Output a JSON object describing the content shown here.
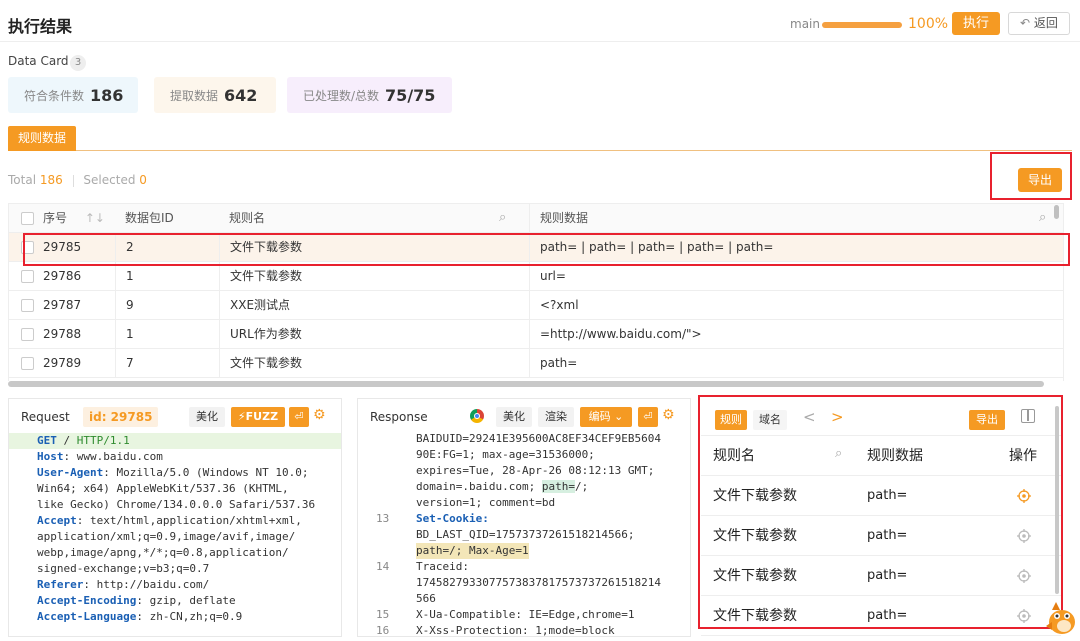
{
  "header": {
    "title": "执行结果",
    "branch": "main",
    "progress": 100,
    "progress_label": "100%",
    "run_label": "执行",
    "back_label": "返回"
  },
  "data_card": {
    "title": "Data Card",
    "count": "3",
    "cards": [
      {
        "label": "符合条件数",
        "value": "186",
        "bg": "#eef7fc"
      },
      {
        "label": "提取数据",
        "value": "642",
        "bg": "#fdf6ec"
      },
      {
        "label": "已处理数/总数",
        "value": "75/75",
        "bg": "#f7eefc"
      }
    ]
  },
  "rules_tab": {
    "label": "规则数据"
  },
  "totals": {
    "total_label": "Total",
    "total": "186",
    "selected_label": "Selected",
    "selected": "0"
  },
  "export_label": "导出",
  "table": {
    "columns": [
      "序号",
      "数据包ID",
      "规则名",
      "规则数据"
    ],
    "rows": [
      {
        "seq": "29785",
        "pkt": "2",
        "rule": "文件下载参数",
        "data": "path= | path= | path= | path= | path="
      },
      {
        "seq": "29786",
        "pkt": "1",
        "rule": "文件下载参数",
        "data": "url="
      },
      {
        "seq": "29787",
        "pkt": "9",
        "rule": "XXE测试点",
        "data": "<?xml"
      },
      {
        "seq": "29788",
        "pkt": "1",
        "rule": "URL作为参数",
        "data": "=http://www.baidu.com/\">"
      },
      {
        "seq": "29789",
        "pkt": "7",
        "rule": "文件下载参数",
        "data": "path="
      }
    ]
  },
  "request": {
    "title": "Request",
    "id_label": "id: 29785",
    "beautify": "美化",
    "fuzz": "FUZZ",
    "lines": [
      {
        "k": "GET",
        "v": " / ",
        "g": "HTTP/1.1"
      },
      {
        "k": "Host",
        "v": ": www.baidu.com"
      },
      {
        "k": "User-Agent",
        "v": ": Mozilla/5.0 (Windows NT 10.0;"
      },
      {
        "v": "Win64; x64) AppleWebKit/537.36 (KHTML,"
      },
      {
        "v": "like Gecko) Chrome/134.0.0.0 Safari/537.36"
      },
      {
        "k": "Accept",
        "v": ": text/html,application/xhtml+xml,"
      },
      {
        "v": "application/xml;q=0.9,image/avif,image/"
      },
      {
        "v": "webp,image/apng,*/*;q=0.8,application/"
      },
      {
        "v": "signed-exchange;v=b3;q=0.7"
      },
      {
        "k": "Referer",
        "v": ": http://baidu.com/"
      },
      {
        "k": "Accept-Encoding",
        "v": ": gzip, deflate"
      },
      {
        "k": "Accept-Language",
        "v": ": zh-CN,zh;q=0.9"
      }
    ]
  },
  "response": {
    "title": "Response",
    "beautify": "美化",
    "render": "渲染",
    "encode": "编码",
    "lines": [
      {
        "n": "",
        "t": "BAIDUID=29241E395600AC8EF34CEF9EB5604"
      },
      {
        "n": "",
        "t": "90E:FG=1; max-age=31536000;"
      },
      {
        "n": "",
        "t": "expires=Tue, 28-Apr-26 08:12:13 GMT;"
      },
      {
        "n": "",
        "t": "domain=.baidu.com; path=/;"
      },
      {
        "n": "",
        "t": "version=1; comment=bd"
      },
      {
        "n": "13",
        "t": "Set-Cookie:",
        "k": true
      },
      {
        "n": "",
        "t": "BD_LAST_QID=17573737261518214566;"
      },
      {
        "n": "",
        "t": "path=/; Max-Age=1"
      },
      {
        "n": "14",
        "t": "Traceid:"
      },
      {
        "n": "",
        "t": "1745827933077573837817573737261518214"
      },
      {
        "n": "",
        "t": "566"
      },
      {
        "n": "15",
        "t": "X-Ua-Compatible: IE=Edge,chrome=1"
      },
      {
        "n": "16",
        "t": "X-Xss-Protection: 1;mode=block"
      }
    ]
  },
  "rule_panel": {
    "tab_rule": "规则",
    "tab_domain": "域名",
    "export": "导出",
    "columns": [
      "规则名",
      "规则数据",
      "操作"
    ],
    "rows": [
      {
        "name": "文件下载参数",
        "data": "path="
      },
      {
        "name": "文件下载参数",
        "data": "path="
      },
      {
        "name": "文件下载参数",
        "data": "path="
      },
      {
        "name": "文件下载参数",
        "data": "path="
      }
    ]
  },
  "colors": {
    "accent": "#f59a23",
    "highlight": "#e8212e"
  }
}
